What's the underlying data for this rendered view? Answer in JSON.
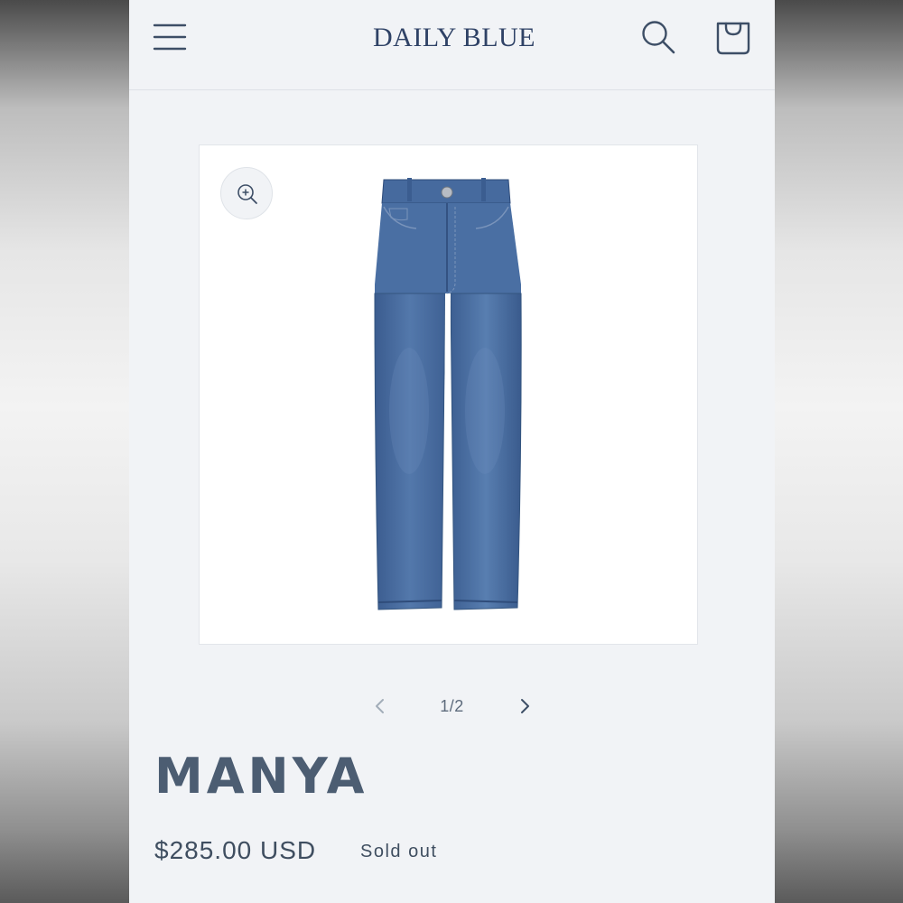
{
  "header": {
    "brand": "DAILY BLUE",
    "menu_icon": "hamburger-menu-icon",
    "search_icon": "search-icon",
    "cart_icon": "shopping-bag-icon"
  },
  "gallery": {
    "zoom_icon": "zoom-in-icon",
    "image_subject": "blue denim jeans",
    "pager": {
      "prev_icon": "chevron-left-icon",
      "count": "1/2",
      "next_icon": "chevron-right-icon"
    }
  },
  "product": {
    "title": "MANYA",
    "price": "$285.00 USD",
    "availability": "Sold out"
  },
  "colors": {
    "brand": "#2f4266",
    "title": "#4c5d72",
    "background": "#f1f3f6",
    "denim": "#44689a"
  }
}
